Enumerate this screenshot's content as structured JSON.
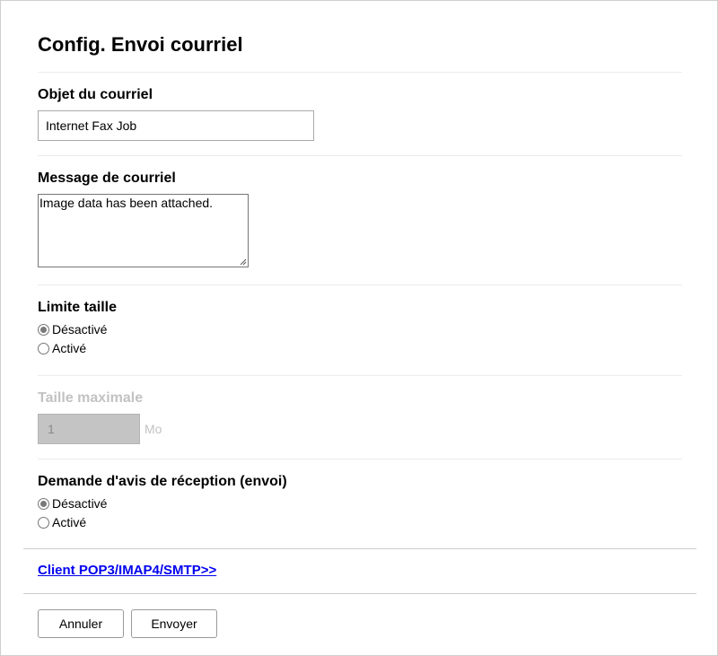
{
  "page": {
    "title": "Config. Envoi courriel"
  },
  "subject": {
    "label": "Objet du courriel",
    "value": "Internet Fax Job"
  },
  "message": {
    "label": "Message de courriel",
    "value": "Image data has been attached."
  },
  "size_limit": {
    "label": "Limite taille",
    "options": [
      "Désactivé",
      "Activé"
    ],
    "selected": "Désactivé"
  },
  "max_size": {
    "label": "Taille maximale",
    "value": "1",
    "unit": "Mo",
    "disabled": true
  },
  "read_receipt": {
    "label": "Demande d'avis de réception (envoi)",
    "options": [
      "Désactivé",
      "Activé"
    ],
    "selected": "Désactivé"
  },
  "links": {
    "client": "Client POP3/IMAP4/SMTP>>"
  },
  "buttons": {
    "cancel": "Annuler",
    "submit": "Envoyer"
  },
  "colors": {
    "link": "#0000ee",
    "disabled_text": "#c2c2c2",
    "disabled_field": "#c4c4c4"
  }
}
